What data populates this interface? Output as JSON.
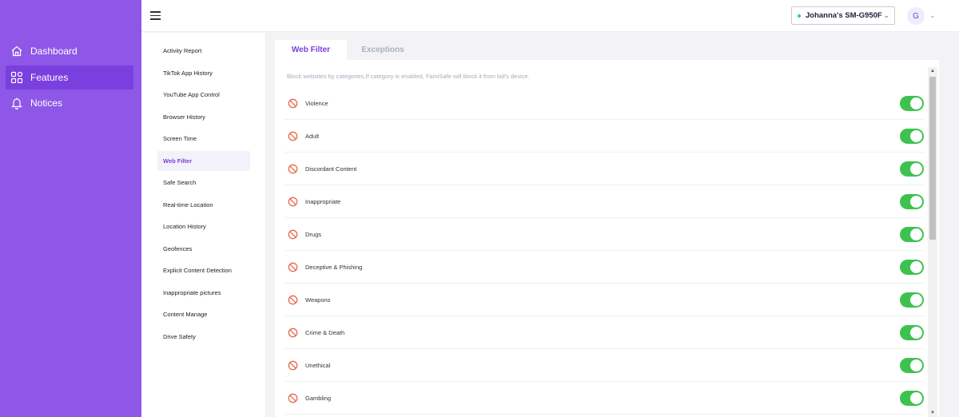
{
  "sidebar": {
    "items": [
      {
        "label": "Dashboard",
        "icon": "home-icon",
        "active": false
      },
      {
        "label": "Features",
        "icon": "grid-icon",
        "active": true
      },
      {
        "label": "Notices",
        "icon": "bell-icon",
        "active": false
      }
    ]
  },
  "header": {
    "device_name": "Johanna's SM-G950F",
    "avatar_initial": "G"
  },
  "submenu": {
    "items": [
      {
        "label": "Activity Report",
        "active": false
      },
      {
        "label": "TikTok App History",
        "active": false
      },
      {
        "label": "YouTube App Control",
        "active": false
      },
      {
        "label": "Browser History",
        "active": false
      },
      {
        "label": "Screen Time",
        "active": false
      },
      {
        "label": "Web Filter",
        "active": true
      },
      {
        "label": "Safe Search",
        "active": false
      },
      {
        "label": "Real-time Location",
        "active": false
      },
      {
        "label": "Location History",
        "active": false
      },
      {
        "label": "Geofences",
        "active": false
      },
      {
        "label": "Explicit Content Detection",
        "active": false
      },
      {
        "label": "Inappropriate pictures",
        "active": false
      },
      {
        "label": "Content Manage",
        "active": false
      },
      {
        "label": "Drive Safety",
        "active": false
      }
    ]
  },
  "tabs": [
    {
      "label": "Web Filter",
      "active": true
    },
    {
      "label": "Exceptions",
      "active": false
    }
  ],
  "web_filter": {
    "description": "Block websites by categories.If category is enabled, FamiSafe will block it from kid's device.",
    "categories": [
      {
        "label": "Violence",
        "enabled": true
      },
      {
        "label": "Adult",
        "enabled": true
      },
      {
        "label": "Discordant Content",
        "enabled": true
      },
      {
        "label": "Inappropriate",
        "enabled": true
      },
      {
        "label": "Drugs",
        "enabled": true
      },
      {
        "label": "Deceptive & Phishing",
        "enabled": true
      },
      {
        "label": "Weapons",
        "enabled": true
      },
      {
        "label": "Crime & Death",
        "enabled": true
      },
      {
        "label": "Unethical",
        "enabled": true
      },
      {
        "label": "Gambling",
        "enabled": true
      }
    ]
  },
  "colors": {
    "sidebar_bg": "#8e57e8",
    "sidebar_active": "#7a3fdf",
    "accent": "#7a3fdf",
    "toggle_on": "#3ec24f",
    "ban_icon": "#e8684a"
  }
}
